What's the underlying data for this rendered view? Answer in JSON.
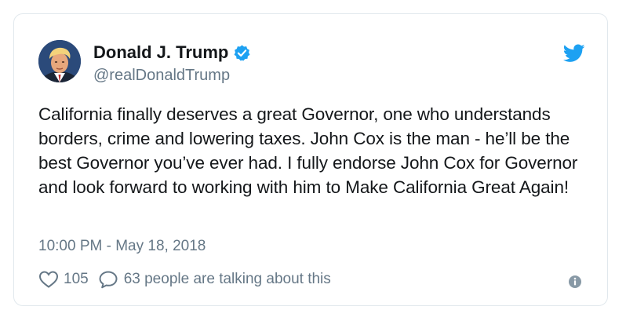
{
  "author": {
    "display_name": "Donald J. Trump",
    "handle": "@realDonaldTrump",
    "verified": true,
    "avatar_icon": "profile-photo"
  },
  "tweet": {
    "text": "California finally deserves a great Governor, one who understands borders, crime and lowering taxes. John Cox is the man - he’ll be the best Governor you’ve ever had. I fully endorse John Cox for Governor and look forward to working with him to Make California Great Again!",
    "timestamp": "10:00 PM - May 18, 2018"
  },
  "actions": {
    "like_count": "105",
    "talking_text": "63 people are talking about this",
    "like_icon": "heart-icon",
    "reply_icon": "speech-bubble-icon",
    "info_icon": "info-icon"
  },
  "branding": {
    "logo": "twitter-bird-icon",
    "colors": {
      "accent": "#1da1f2",
      "text": "#14171a",
      "muted": "#657786",
      "border": "#e1e8ed"
    }
  }
}
